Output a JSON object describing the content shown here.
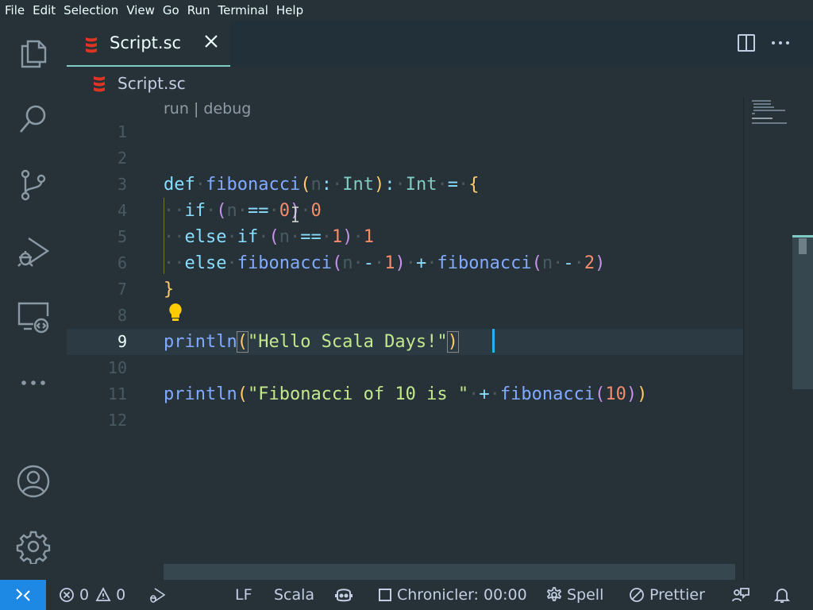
{
  "menu": [
    "File",
    "Edit",
    "Selection",
    "View",
    "Go",
    "Run",
    "Terminal",
    "Help"
  ],
  "activity_bar": {
    "items": [
      "explorer-icon",
      "search-icon",
      "source-control-icon",
      "run-debug-icon",
      "remote-explorer-icon",
      "more-icon"
    ],
    "bottom": [
      "account-icon",
      "settings-gear-icon"
    ]
  },
  "tab": {
    "name": "Script.sc",
    "icon": "scala-icon",
    "close": "close-icon"
  },
  "editor_actions": [
    "split-editor-icon",
    "more-actions-icon"
  ],
  "breadcrumb": {
    "file": "Script.sc"
  },
  "codelens": {
    "run": "run",
    "sep": " | ",
    "debug": "debug"
  },
  "code": {
    "line_numbers": [
      "1",
      "2",
      "3",
      "4",
      "5",
      "6",
      "7",
      "8",
      "9",
      "10",
      "11",
      "12"
    ],
    "current_line": "9",
    "lines": {
      "l3": [
        "def",
        "fibonacci",
        "(",
        "n",
        ":",
        "Int",
        ")",
        ":",
        "Int",
        "=",
        "{"
      ],
      "l4": [
        "if",
        "(",
        "n",
        "==",
        "0",
        ")",
        "0"
      ],
      "l5": [
        "else",
        "if",
        "(",
        "n",
        "==",
        "1",
        ")",
        "1"
      ],
      "l6": [
        "else",
        "fibonacci",
        "(",
        "n",
        "-",
        "1",
        ")",
        "+",
        "fibonacci",
        "(",
        "n",
        "-",
        "2",
        ")"
      ],
      "l7": [
        "}"
      ],
      "l9": [
        "println",
        "(",
        "\"Hello Scala Days!\"",
        ")"
      ],
      "l11": [
        "println",
        "(",
        "\"Fibonacci of 10 is \"",
        "+",
        "fibonacci",
        "(",
        "10",
        ")",
        ")"
      ]
    }
  },
  "status": {
    "errors": "0",
    "warnings": "0",
    "eol": "LF",
    "language": "Scala",
    "chronicler": "Chronicler: 00:00",
    "spell": "Spell",
    "prettier": "Prettier"
  },
  "colors": {
    "background": "#263238",
    "accent": "#80cbc4",
    "remote": "#1e88e5",
    "keyword": "#89ddff",
    "function": "#82aaff",
    "string": "#c3e88d",
    "number": "#f78c6c"
  }
}
